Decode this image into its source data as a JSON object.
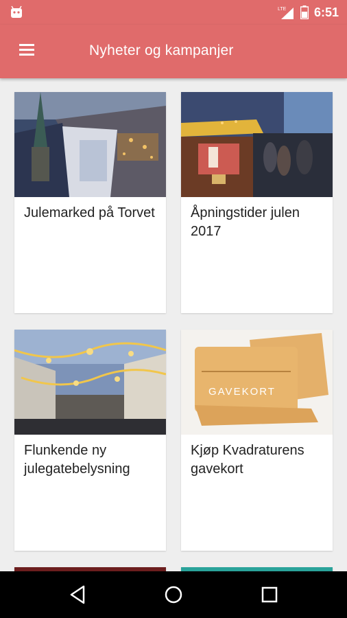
{
  "status_bar": {
    "time": "6:51",
    "network": "LTE",
    "icons": [
      "android-icon",
      "lte-signal-icon",
      "battery-icon"
    ]
  },
  "app_bar": {
    "title": "Nyheter og kampanjer",
    "menu_icon": "hamburger-menu-icon"
  },
  "cards": [
    {
      "title": "Julemarked på Torvet",
      "image": "christmas-market-aerial-photo"
    },
    {
      "title": "Åpningstider julen 2017",
      "image": "market-stall-photo"
    },
    {
      "title": "Flunkende ny julegatebelysning",
      "image": "street-lights-photo"
    },
    {
      "title": "Kjøp Kvadraturens gavekort",
      "image": "gift-card-photo",
      "card_text": "GAVEKORT"
    }
  ],
  "nav_bar": {
    "icons": [
      "back-icon",
      "home-icon",
      "recents-icon"
    ]
  },
  "colors": {
    "accent": "#e06b6b",
    "background": "#eeeeee",
    "card": "#ffffff"
  }
}
